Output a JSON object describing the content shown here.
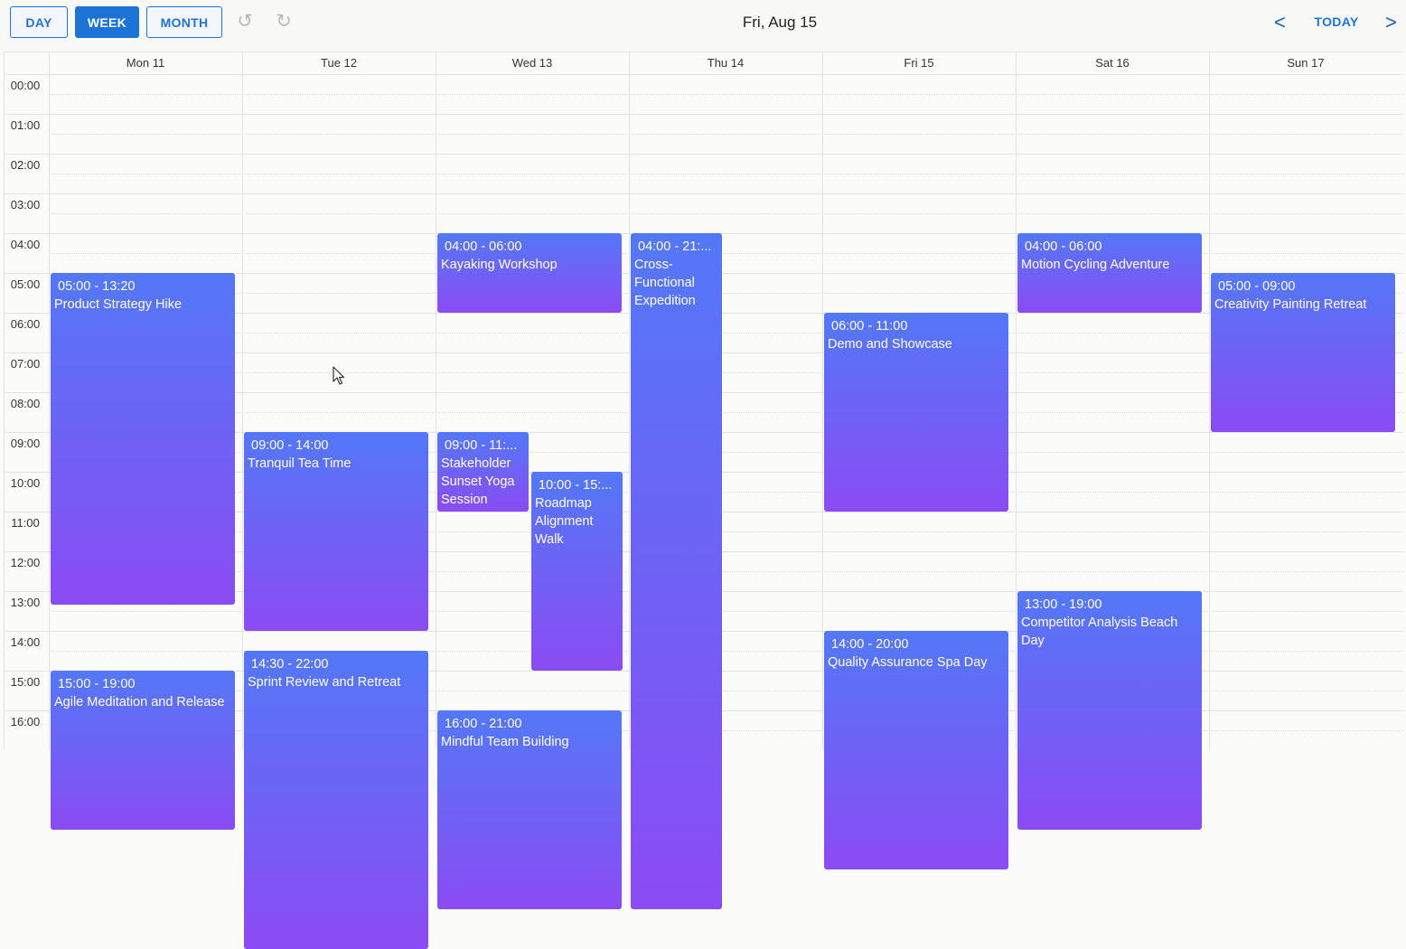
{
  "toolbar": {
    "view_buttons": [
      "DAY",
      "WEEK",
      "MONTH"
    ],
    "active_view": "WEEK",
    "current_date": "Fri, Aug 15",
    "prev_label": "<",
    "today_label": "TODAY",
    "next_label": ">"
  },
  "days": [
    "Mon 11",
    "Tue 12",
    "Wed 13",
    "Thu 14",
    "Fri 15",
    "Sat 16",
    "Sun 17"
  ],
  "hours": [
    "00:00",
    "01:00",
    "02:00",
    "03:00",
    "04:00",
    "05:00",
    "06:00",
    "07:00",
    "08:00",
    "09:00",
    "10:00",
    "11:00",
    "12:00",
    "13:00",
    "14:00",
    "15:00",
    "16:00"
  ],
  "events": [
    {
      "day": 0,
      "start": 5,
      "end": 13.333,
      "time": "05:00 - 13:20",
      "title": "Product Strategy Hike"
    },
    {
      "day": 0,
      "start": 15,
      "end": 19,
      "time": "15:00 - 19:00",
      "title": "Agile Meditation and Release"
    },
    {
      "day": 1,
      "start": 9,
      "end": 14,
      "time": "09:00 - 14:00",
      "title": "Tranquil Tea Time"
    },
    {
      "day": 1,
      "start": 14.5,
      "end": 22,
      "time": "14:30 - 22:00",
      "title": "Sprint Review and Retreat"
    },
    {
      "day": 2,
      "start": 4,
      "end": 6,
      "time": "04:00 - 06:00",
      "title": "Kayaking Workshop"
    },
    {
      "day": 2,
      "start": 9,
      "end": 11,
      "lane": 0,
      "lanes": 2,
      "time": "09:00 - 11:...",
      "title": "Stakeholder Sunset Yoga Session"
    },
    {
      "day": 2,
      "start": 10,
      "end": 15,
      "lane": 1,
      "lanes": 2,
      "time": "10:00 - 15:...",
      "title": "Roadmap Alignment Walk"
    },
    {
      "day": 2,
      "start": 16,
      "end": 21,
      "time": "16:00 - 21:00",
      "title": "Mindful Team Building"
    },
    {
      "day": 3,
      "start": 4,
      "end": 21,
      "lane": 0,
      "lanes": 2,
      "time": "04:00 - 21:...",
      "title": "Cross-Functional Expedition"
    },
    {
      "day": 4,
      "start": 6,
      "end": 11,
      "time": "06:00 - 11:00",
      "title": "Demo and Showcase"
    },
    {
      "day": 4,
      "start": 14,
      "end": 20,
      "time": "14:00 - 20:00",
      "title": "Quality Assurance Spa Day"
    },
    {
      "day": 5,
      "start": 4,
      "end": 6,
      "time": "04:00 - 06:00",
      "title": "Motion Cycling Adventure"
    },
    {
      "day": 5,
      "start": 13,
      "end": 19,
      "time": "13:00 - 19:00",
      "title": "Competitor Analysis Beach Day"
    },
    {
      "day": 6,
      "start": 5,
      "end": 9,
      "time": "05:00 - 09:00",
      "title": "Creativity Painting Retreat"
    }
  ]
}
